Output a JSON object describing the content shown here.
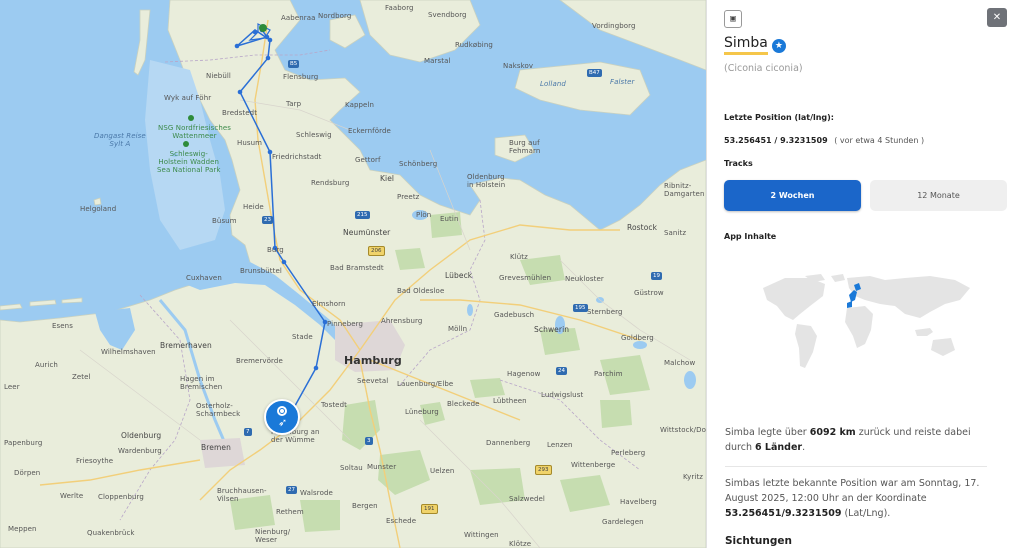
{
  "map": {
    "places": [
      {
        "name": "Aabenraa",
        "cls": ""
      },
      {
        "name": "Nordborg",
        "cls": ""
      },
      {
        "name": "Faaborg",
        "cls": ""
      },
      {
        "name": "Svendborg",
        "cls": ""
      },
      {
        "name": "Vordingborg",
        "cls": ""
      },
      {
        "name": "Rudkøbing",
        "cls": ""
      },
      {
        "name": "Marstal",
        "cls": ""
      },
      {
        "name": "Nakskov",
        "cls": ""
      },
      {
        "name": "Lolland",
        "cls": "water"
      },
      {
        "name": "Falster",
        "cls": "water"
      },
      {
        "name": "Flensburg",
        "cls": ""
      },
      {
        "name": "Niebüll",
        "cls": ""
      },
      {
        "name": "Wyk auf Föhr",
        "cls": ""
      },
      {
        "name": "Bredstedt",
        "cls": ""
      },
      {
        "name": "Tarp",
        "cls": ""
      },
      {
        "name": "Kappeln",
        "cls": ""
      },
      {
        "name": "Dangast Reise\nSylt A",
        "cls": "water"
      },
      {
        "name": "NSG Nordfriesisches\nWattenmeer",
        "cls": "park"
      },
      {
        "name": "Schleswig-\nHolstein Wadden\nSea National Park",
        "cls": "park"
      },
      {
        "name": "Husum",
        "cls": ""
      },
      {
        "name": "Schleswig",
        "cls": ""
      },
      {
        "name": "Eckernförde",
        "cls": ""
      },
      {
        "name": "Burg auf\nFehmarn",
        "cls": ""
      },
      {
        "name": "Gettorf",
        "cls": ""
      },
      {
        "name": "Schönberg",
        "cls": ""
      },
      {
        "name": "Friedrichstadt",
        "cls": ""
      },
      {
        "name": "Kiel",
        "cls": "med"
      },
      {
        "name": "Oldenburg\nin Holstein",
        "cls": ""
      },
      {
        "name": "Rendsburg",
        "cls": ""
      },
      {
        "name": "Ribnitz-\nDamgarten",
        "cls": ""
      },
      {
        "name": "Helgoland",
        "cls": ""
      },
      {
        "name": "Heide",
        "cls": ""
      },
      {
        "name": "Preetz",
        "cls": ""
      },
      {
        "name": "Plön",
        "cls": ""
      },
      {
        "name": "Eutin",
        "cls": ""
      },
      {
        "name": "Büsum",
        "cls": ""
      },
      {
        "name": "Neumünster",
        "cls": "med"
      },
      {
        "name": "Rostock",
        "cls": "med"
      },
      {
        "name": "Sanitz",
        "cls": ""
      },
      {
        "name": "Burg",
        "cls": ""
      },
      {
        "name": "Klütz",
        "cls": ""
      },
      {
        "name": "Brunsbüttel",
        "cls": ""
      },
      {
        "name": "Bad Bramstedt",
        "cls": ""
      },
      {
        "name": "Lübeck",
        "cls": "med"
      },
      {
        "name": "Grevesmühlen",
        "cls": ""
      },
      {
        "name": "Neukloster",
        "cls": ""
      },
      {
        "name": "Cuxhaven",
        "cls": ""
      },
      {
        "name": "Bad Oldesloe",
        "cls": ""
      },
      {
        "name": "Güstrow",
        "cls": ""
      },
      {
        "name": "Gadebusch",
        "cls": ""
      },
      {
        "name": "Sternberg",
        "cls": ""
      },
      {
        "name": "Elmshorn",
        "cls": ""
      },
      {
        "name": "Pinneberg",
        "cls": ""
      },
      {
        "name": "Ahrensburg",
        "cls": ""
      },
      {
        "name": "Esens",
        "cls": ""
      },
      {
        "name": "Schwerin",
        "cls": "med"
      },
      {
        "name": "Mölln",
        "cls": ""
      },
      {
        "name": "Goldberg",
        "cls": ""
      },
      {
        "name": "Bremerhaven",
        "cls": "med"
      },
      {
        "name": "Stade",
        "cls": ""
      },
      {
        "name": "Hamburg",
        "cls": "big"
      },
      {
        "name": "Wilhelmshaven",
        "cls": ""
      },
      {
        "name": "Aurich",
        "cls": ""
      },
      {
        "name": "Bremervörde",
        "cls": ""
      },
      {
        "name": "Hagenow",
        "cls": ""
      },
      {
        "name": "Parchim",
        "cls": ""
      },
      {
        "name": "Malchow",
        "cls": ""
      },
      {
        "name": "Zetel",
        "cls": ""
      },
      {
        "name": "Hagen im\nBremischen",
        "cls": ""
      },
      {
        "name": "Seevetal",
        "cls": ""
      },
      {
        "name": "Lauenburg/Elbe",
        "cls": ""
      },
      {
        "name": "Ludwigslust",
        "cls": ""
      },
      {
        "name": "Leer",
        "cls": ""
      },
      {
        "name": "Osterholz-\nScharmbeck",
        "cls": ""
      },
      {
        "name": "Tostedt",
        "cls": ""
      },
      {
        "name": "Lüneburg",
        "cls": ""
      },
      {
        "name": "Bleckede",
        "cls": ""
      },
      {
        "name": "Lübtheen",
        "cls": ""
      },
      {
        "name": "Rotenburg an\nder Wümme",
        "cls": ""
      },
      {
        "name": "Wittstock/Dosse",
        "cls": ""
      },
      {
        "name": "Oldenburg",
        "cls": "med"
      },
      {
        "name": "Papenburg",
        "cls": ""
      },
      {
        "name": "Friesoythe",
        "cls": ""
      },
      {
        "name": "Wardenburg",
        "cls": ""
      },
      {
        "name": "Bremen",
        "cls": "med"
      },
      {
        "name": "Soltau",
        "cls": ""
      },
      {
        "name": "Munster",
        "cls": ""
      },
      {
        "name": "Uelzen",
        "cls": ""
      },
      {
        "name": "Dannenberg",
        "cls": ""
      },
      {
        "name": "Lenzen",
        "cls": ""
      },
      {
        "name": "Perleberg",
        "cls": ""
      },
      {
        "name": "Kyritz",
        "cls": ""
      },
      {
        "name": "Dörpen",
        "cls": ""
      },
      {
        "name": "Werlte",
        "cls": ""
      },
      {
        "name": "Cloppenburg",
        "cls": ""
      },
      {
        "name": "Bruchhausen-\nVilsen",
        "cls": ""
      },
      {
        "name": "Walsrode",
        "cls": ""
      },
      {
        "name": "Salzwedel",
        "cls": ""
      },
      {
        "name": "Wittenberge",
        "cls": ""
      },
      {
        "name": "Havelberg",
        "cls": ""
      },
      {
        "name": "Meppen",
        "cls": ""
      },
      {
        "name": "Quakenbrück",
        "cls": ""
      },
      {
        "name": "Rethem",
        "cls": ""
      },
      {
        "name": "Bergen",
        "cls": ""
      },
      {
        "name": "Eschede",
        "cls": ""
      },
      {
        "name": "Gardelegen",
        "cls": ""
      },
      {
        "name": "Nienburg/\nWeser",
        "cls": ""
      },
      {
        "name": "Klötze",
        "cls": ""
      },
      {
        "name": "Wittingen",
        "cls": ""
      }
    ],
    "shields": [
      "B47",
      "B5",
      "215",
      "206",
      "3",
      "27",
      "7",
      "293",
      "191",
      "195",
      "19",
      "24",
      "23"
    ]
  },
  "panel": {
    "icon_glyph": "▣",
    "close_glyph": "✕",
    "animal_name": "Simba",
    "verified_glyph": "★",
    "species": "(Ciconia ciconia)",
    "position_label": "Letzte Position (lat/lng):",
    "position_value": "53.256451 / 9.3231509",
    "position_age": "( vor etwa 4 Stunden )",
    "tracks_label": "Tracks",
    "track_2w": "2 Wochen",
    "track_12m": "12 Monate",
    "app_label": "App Inhalte",
    "desc1_a": "Simba legte über ",
    "desc1_km": "6092 km",
    "desc1_b": " zurück und reiste dabei durch ",
    "desc1_countries": "6 Länder",
    "desc1_c": ".",
    "desc2_a": "Simbas letzte bekannte Position war am Sonntag, 17. August 2025, 12:00 Uhr an der Koordinate ",
    "desc2_coord": "53.256451/9.3231509",
    "desc2_b": " (Lat/Lng).",
    "sightings_label": "Sichtungen"
  },
  "colors": {
    "accent": "#1b66c9",
    "track": "#2a6fd6",
    "highlight": "#f5c64a",
    "land": "#e8ecd8",
    "water": "#9ccbf1",
    "forest": "#c9e0b0"
  }
}
